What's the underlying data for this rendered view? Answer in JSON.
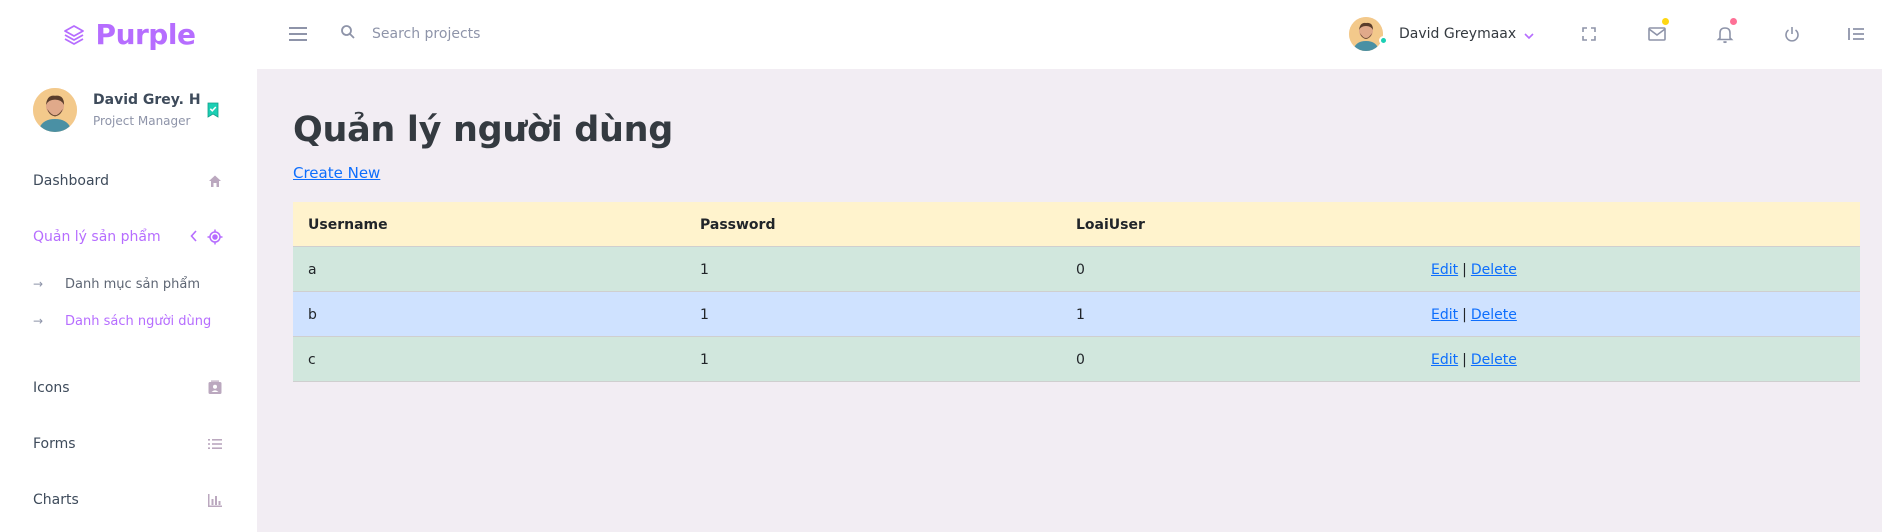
{
  "brand": {
    "name": "Purple",
    "accent": "#b66dff"
  },
  "search": {
    "placeholder": "Search projects"
  },
  "topbar": {
    "user_name": "David Greymaax",
    "icons": [
      "fullscreen-icon",
      "mail-icon",
      "bell-icon",
      "power-icon",
      "list-icon"
    ]
  },
  "sidebar": {
    "profile": {
      "name": "David Grey. H",
      "role": "Project Manager"
    },
    "items": [
      {
        "label": "Dashboard",
        "icon": "home-icon"
      },
      {
        "label": "Quản lý sản phẩm",
        "icon": "crosshairs-icon",
        "active": true
      },
      {
        "label": "Icons",
        "icon": "contacts-icon"
      },
      {
        "label": "Forms",
        "icon": "format-list-icon"
      },
      {
        "label": "Charts",
        "icon": "chart-bar-icon"
      }
    ],
    "sub_items": [
      {
        "label": "Danh mục sản phẩm"
      },
      {
        "label": "Danh sách người dùng",
        "active": true
      }
    ]
  },
  "main": {
    "title": "Quản lý người dùng",
    "create_link": "Create New",
    "table": {
      "headers": [
        "Username",
        "Password",
        "LoaiUser",
        ""
      ],
      "rows": [
        {
          "username": "a",
          "password": "1",
          "loaiuser": "0",
          "edit": "Edit",
          "sep": "|",
          "delete": "Delete"
        },
        {
          "username": "b",
          "password": "1",
          "loaiuser": "1",
          "edit": "Edit",
          "sep": "|",
          "delete": "Delete"
        },
        {
          "username": "c",
          "password": "1",
          "loaiuser": "0",
          "edit": "Edit",
          "sep": "|",
          "delete": "Delete"
        }
      ]
    }
  }
}
